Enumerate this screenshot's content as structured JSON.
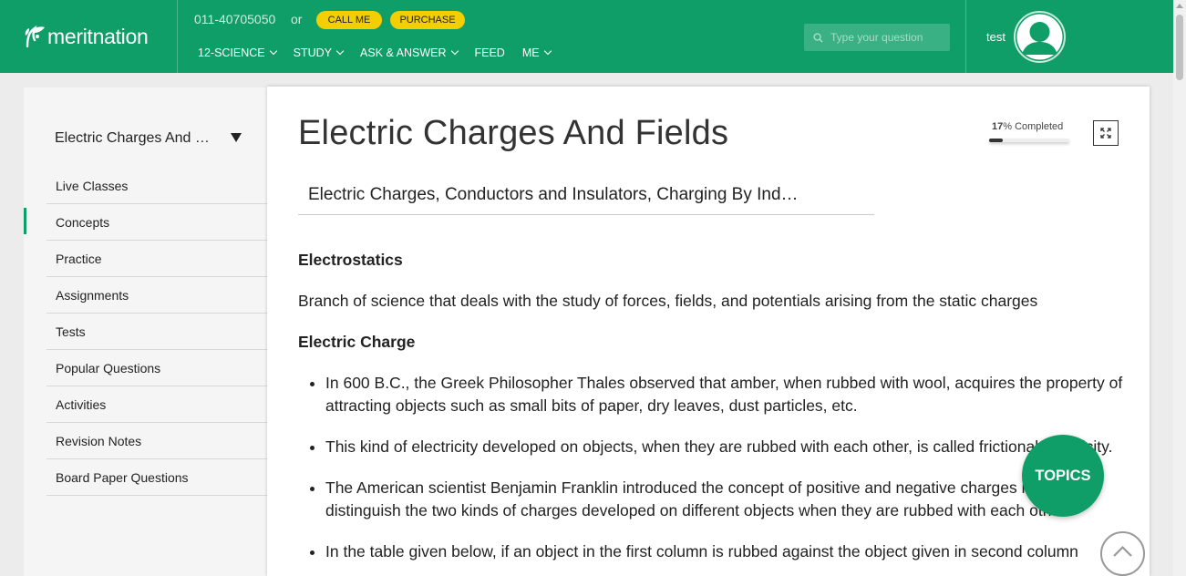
{
  "header": {
    "logo_text": "meritnation",
    "phone": "011-40705050",
    "or_text": "or",
    "call_me_label": "CALL ME",
    "purchase_label": "PURCHASE",
    "nav": [
      {
        "label": "12-SCIENCE"
      },
      {
        "label": "STUDY"
      },
      {
        "label": "ASK & ANSWER"
      },
      {
        "label": "FEED"
      },
      {
        "label": "ME"
      }
    ],
    "search_placeholder": "Type your question",
    "username": "test",
    "accent_color": "#0f9d68",
    "pill_color": "#f4cf00"
  },
  "sidebar": {
    "chapter": "Electric Charges And …",
    "items": [
      {
        "label": "Live Classes"
      },
      {
        "label": "Concepts",
        "active": true
      },
      {
        "label": "Practice"
      },
      {
        "label": "Assignments"
      },
      {
        "label": "Tests"
      },
      {
        "label": "Popular Questions"
      },
      {
        "label": "Activities"
      },
      {
        "label": "Revision Notes"
      },
      {
        "label": "Board Paper Questions"
      }
    ]
  },
  "main": {
    "title": "Electric Charges And Fields",
    "progress_percent": 17,
    "progress_suffix": "% Completed",
    "topic": "Electric Charges, Conductors and Insulators, Charging By Ind…",
    "heading1": "Electrostatics",
    "para1": "Branch of science that deals with the study of forces, fields, and potentials arising from the static charges",
    "heading2": "Electric Charge",
    "bullets": [
      "In 600 B.C., the Greek Philosopher Thales observed that amber, when rubbed with wool, acquires the property of attracting objects such as small bits of paper, dry leaves, dust particles, etc.",
      "This kind of electricity developed on objects, when they are rubbed with each other, is called frictional electricity.",
      "The American scientist Benjamin Franklin introduced the concept of positive and negative charges in order to distinguish the two kinds of charges developed on different objects when they are rubbed with each other.",
      "In the table given below, if an object in the first column is rubbed against the object given in second column"
    ]
  },
  "floating": {
    "topics_label": "TOPICS"
  }
}
